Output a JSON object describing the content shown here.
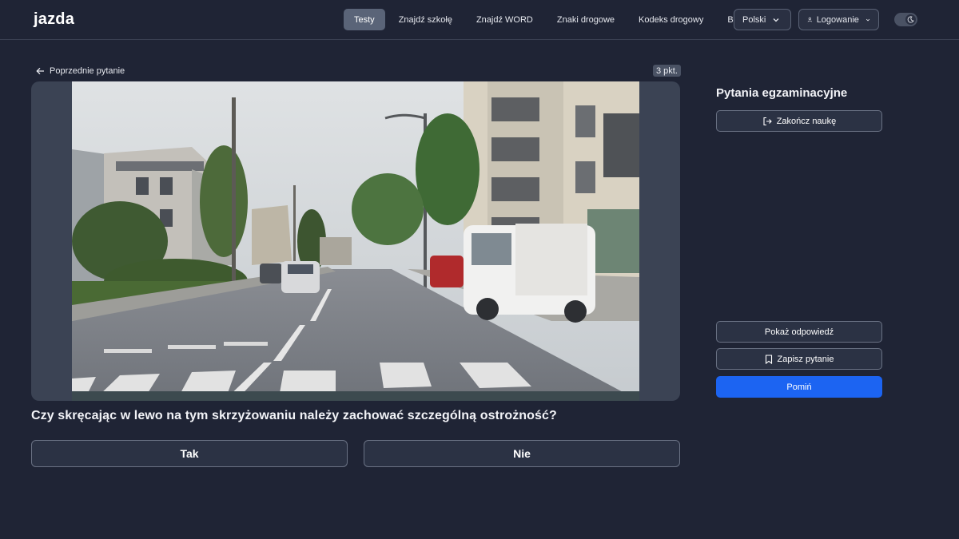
{
  "header": {
    "logo_text": "jazda",
    "nav": [
      {
        "label": "Testy",
        "active": true
      },
      {
        "label": "Znajdź szkołę",
        "active": false
      },
      {
        "label": "Znajdź WORD",
        "active": false
      },
      {
        "label": "Znaki drogowe",
        "active": false
      },
      {
        "label": "Kodeks drogowy",
        "active": false
      },
      {
        "label": "Blog",
        "active": false
      }
    ],
    "language_label": "Polski",
    "login_label": "Logowanie",
    "theme_toggle_icon": "moon-icon"
  },
  "main": {
    "back_label": "Poprzednie pytanie",
    "points_label": "3 pkt.",
    "question": "Czy skręcając w lewo na tym skrzyżowaniu należy zachować szczególną ostrożność?",
    "answers": [
      {
        "label": "Tak"
      },
      {
        "label": "Nie"
      }
    ]
  },
  "sidebar": {
    "title": "Pytania egzaminacyjne",
    "end_label": "Zakończ naukę",
    "show_answer_label": "Pokaż odpowiedź",
    "save_label": "Zapisz pytanie",
    "skip_label": "Pomiń"
  },
  "colors": {
    "background": "#1f2435",
    "accent": "#1c64f2",
    "logo_accent": "#3d7bff"
  }
}
